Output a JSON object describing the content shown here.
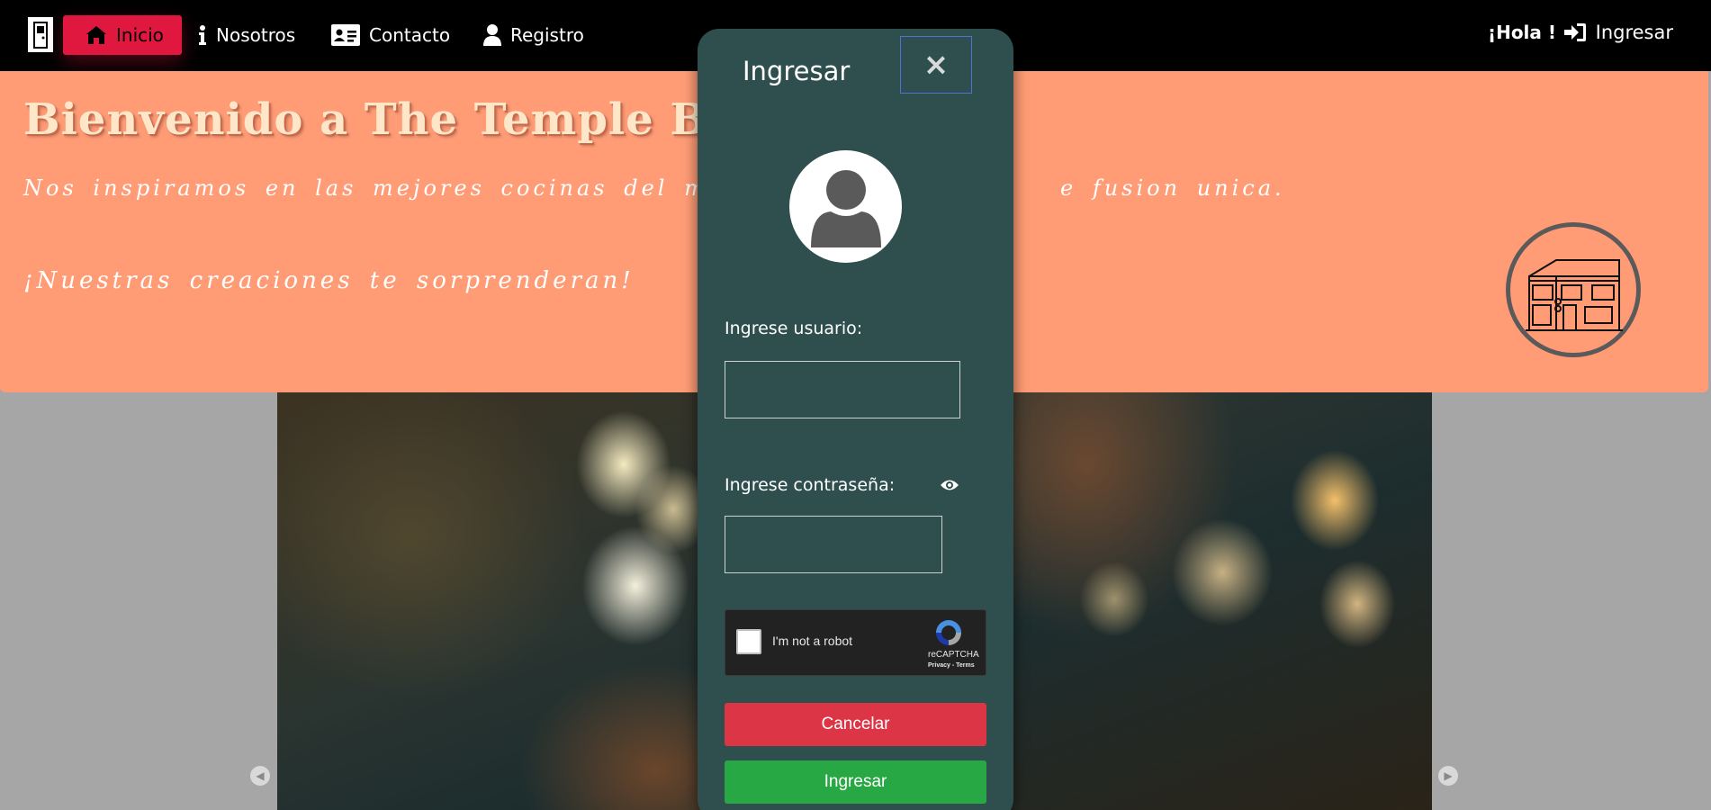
{
  "nav": {
    "items": [
      {
        "label": "Inicio",
        "icon": "home-icon",
        "active": true
      },
      {
        "label": "Nosotros",
        "icon": "info-icon"
      },
      {
        "label": "Contacto",
        "icon": "address-card-icon"
      },
      {
        "label": "Registro",
        "icon": "user-icon"
      }
    ],
    "greeting": "¡Hola !",
    "login_label": "Ingresar"
  },
  "hero": {
    "title": "Bienvenido a The Temple Bar",
    "subtitle": "Nos inspiramos en las mejores cocinas del mundo y s",
    "subtitle_tail": "e fusion unica.",
    "tagline": "¡Nuestras creaciones te sorprenderan!"
  },
  "modal": {
    "title": "Ingresar",
    "close_symbol": "×",
    "user_label": "Ingrese usuario:",
    "user_value": "",
    "password_label": "Ingrese contraseña:",
    "password_value": "",
    "recaptcha": {
      "text": "I'm not a robot",
      "brand": "reCAPTCHA",
      "links": "Privacy - Terms"
    },
    "cancel_label": "Cancelar",
    "submit_label": "Ingresar"
  },
  "colors": {
    "navbar": "#000000",
    "active_nav": "#e0173f",
    "hero_bg": "#ff9c76",
    "hero_title": "#fde7c8",
    "modal_bg": "#2f4f4f",
    "cancel": "#dc3545",
    "submit": "#28a745"
  }
}
